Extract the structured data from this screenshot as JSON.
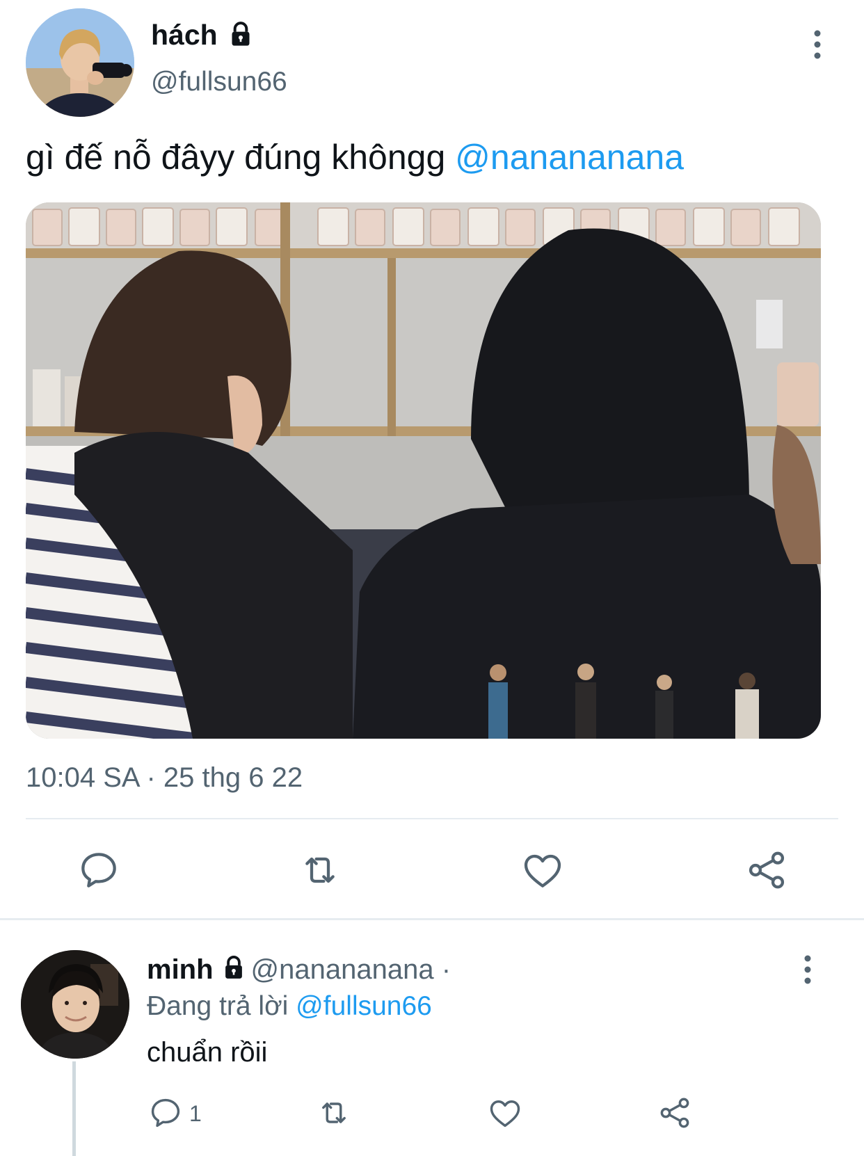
{
  "tweet": {
    "author": {
      "display_name": "hách",
      "handle": "@fullsun66",
      "protected": true
    },
    "text": "gì đế nỗ đâyy đúng khôngg ",
    "mention": "@nanananana",
    "timestamp": "10:04 SA · 25 thg 6 22",
    "actions": [
      "reply-icon",
      "retweet-icon",
      "like-icon",
      "share-icon"
    ]
  },
  "reply": {
    "author": {
      "display_name": "minh",
      "handle": "@nanananana",
      "protected": true
    },
    "separator": " · ",
    "replying_to_prefix": "Đang trả lời ",
    "replying_to_handle": "@fullsun66",
    "text": "chuẩn rồii",
    "reply_count": "1",
    "actions": [
      "reply-icon",
      "retweet-icon",
      "like-icon",
      "share-icon"
    ]
  },
  "colors": {
    "accent": "#1d9bf0",
    "secondary_text": "#536471",
    "primary_text": "#0f1419",
    "divider": "#e6ecf0"
  }
}
